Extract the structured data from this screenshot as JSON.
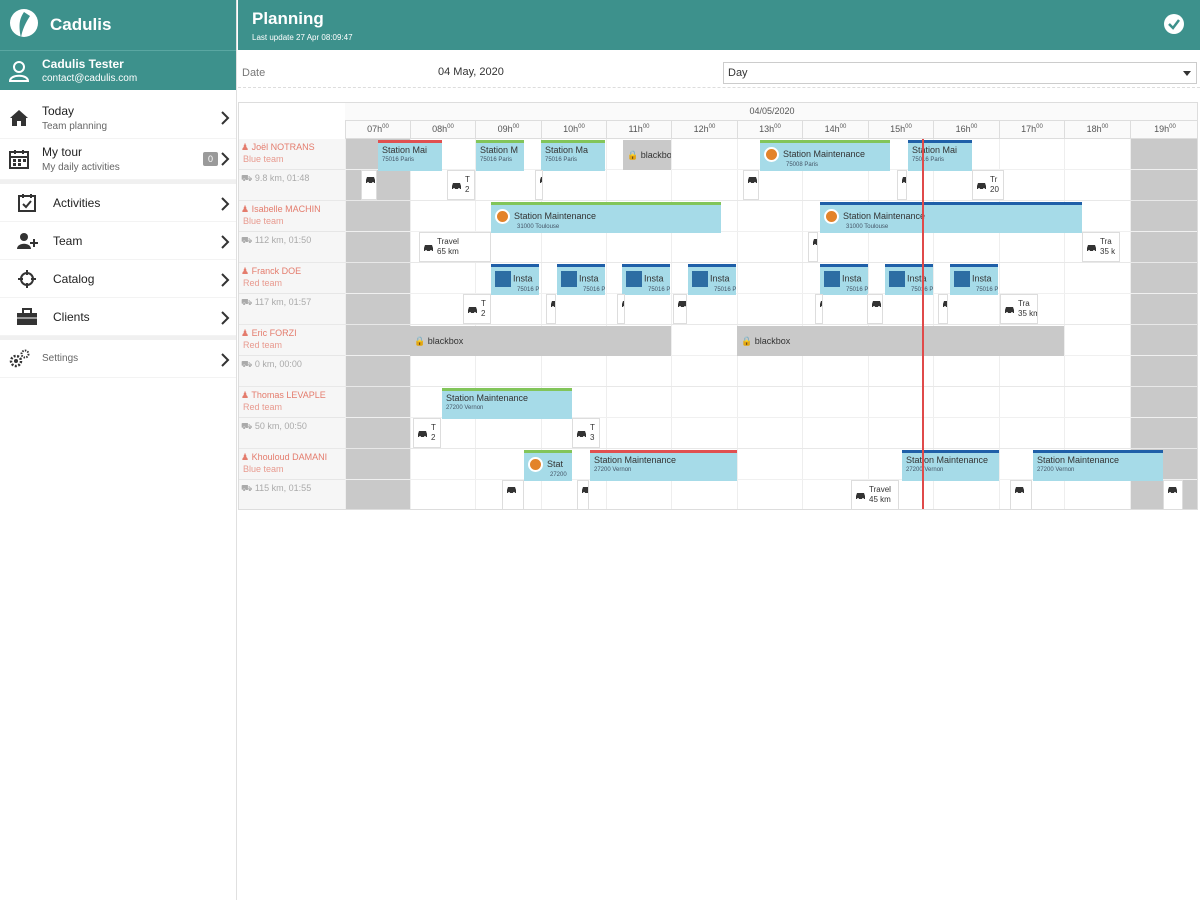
{
  "app": {
    "name": "Cadulis"
  },
  "user": {
    "name": "Cadulis Tester",
    "email": "contact@cadulis.com"
  },
  "nav": {
    "today": {
      "label": "Today",
      "sub": "Team planning"
    },
    "mytour": {
      "label": "My tour",
      "sub": "My daily activities",
      "badge": "0"
    },
    "activities": "Activities",
    "team": "Team",
    "catalog": "Catalog",
    "clients": "Clients",
    "settings": "Settings"
  },
  "header": {
    "title": "Planning",
    "last_update": "Last update 27 Apr 08:09:47"
  },
  "filters": {
    "date_label": "Date",
    "date_value": "04 May, 2020",
    "view_value": "Day"
  },
  "planning": {
    "date": "04/05/2020",
    "hours": [
      "07h",
      "08h",
      "09h",
      "10h",
      "11h",
      "12h",
      "13h",
      "14h",
      "15h",
      "16h",
      "17h",
      "18h",
      "19h"
    ],
    "hour_suffix": "00",
    "rows": [
      {
        "name": "Joël NOTRANS",
        "team": "Blue team",
        "dist": "9.8 km, 01:48"
      },
      {
        "name": "Isabelle MACHIN",
        "team": "Blue team",
        "dist": "112 km, 01:50"
      },
      {
        "name": "Franck DOE",
        "team": "Red team",
        "dist": "117 km, 01:57"
      },
      {
        "name": "Eric FORZI",
        "team": "Red team",
        "dist": "0 km, 00:00"
      },
      {
        "name": "Thomas LEVAPLE",
        "team": "Red team",
        "dist": "50 km, 00:50"
      },
      {
        "name": "Khouloud DAMANI",
        "team": "Blue team",
        "dist": "115 km, 01:55"
      }
    ],
    "labels": {
      "station_maintenance": "Station Maintenance",
      "station_m_short": "Station M",
      "station_mai": "Station Mai",
      "station_ma": "Station Ma",
      "stat": "Stat",
      "insta": "Insta",
      "blackbox": "blackbox",
      "blackbo": "blackbo",
      "travel": "Travel",
      "tra": "Tra",
      "t": "T",
      "tr": "Tr",
      "paris": "75016 Paris",
      "paris2": "75008 Paris",
      "toulouse": "31000 Toulouse",
      "vernon": "27200 Vernon",
      "vernon_short": "27200",
      "km65": "65 km",
      "km35": "35 k",
      "km45": "45 km",
      "km35b": "35 km",
      "n2": "2",
      "n20": "20",
      "n3": "3",
      "dash": "-"
    }
  },
  "colors": {
    "brand": "#3d918c",
    "task": "#a6dbe8",
    "now_line": "#e04a4a",
    "offhours": "#c9c9c9"
  }
}
